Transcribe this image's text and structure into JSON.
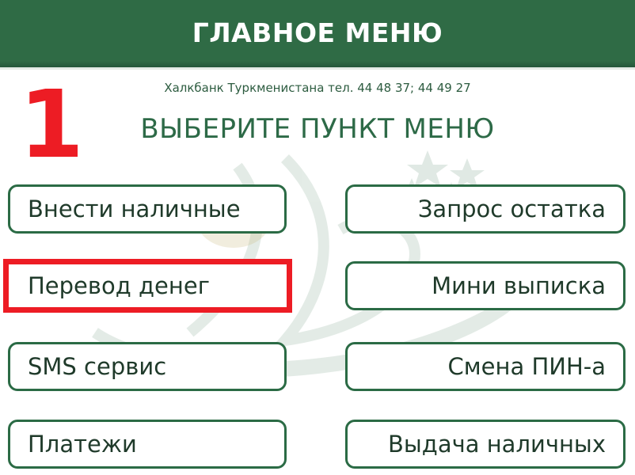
{
  "header": {
    "title": "ГЛАВНОЕ МЕНЮ",
    "color": "#2f6b45"
  },
  "bank_info": "Халкбанк Туркменистана тел. 44 48 37; 44 49 27",
  "page_title": "ВЫБЕРИТЕ ПУНКТ МЕНЮ",
  "annotation": {
    "step_number": "1",
    "color": "#ed1c24"
  },
  "watermark": {
    "icon": "bank-logo-watermark"
  },
  "menu": {
    "left": [
      {
        "label": "Внести наличные"
      },
      {
        "label": "Перевод денег"
      },
      {
        "label": "SMS сервис"
      },
      {
        "label": "Платежи"
      }
    ],
    "right": [
      {
        "label": "Запрос остатка"
      },
      {
        "label": "Мини выписка"
      },
      {
        "label": "Смена ПИН-а"
      },
      {
        "label": "Выдача наличных"
      }
    ]
  }
}
